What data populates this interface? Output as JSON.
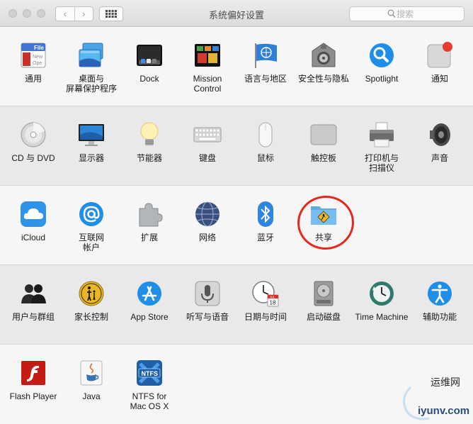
{
  "window": {
    "title": "系统偏好设置",
    "back_glyph": "‹",
    "forward_glyph": "›",
    "search_placeholder": "搜索"
  },
  "sections": [
    [
      {
        "label": "通用",
        "icon": "general-icon"
      },
      {
        "label": "桌面与\n屏幕保护程序",
        "icon": "desktop-screensaver-icon"
      },
      {
        "label": "Dock",
        "icon": "dock-icon"
      },
      {
        "label": "Mission\nControl",
        "icon": "mission-control-icon"
      },
      {
        "label": "语言与地区",
        "icon": "language-region-icon"
      },
      {
        "label": "安全性与隐私",
        "icon": "security-privacy-icon"
      },
      {
        "label": "Spotlight",
        "icon": "spotlight-icon"
      },
      {
        "label": "通知",
        "icon": "notifications-icon"
      }
    ],
    [
      {
        "label": "CD 与 DVD",
        "icon": "cd-dvd-icon"
      },
      {
        "label": "显示器",
        "icon": "displays-icon"
      },
      {
        "label": "节能器",
        "icon": "energy-saver-icon"
      },
      {
        "label": "键盘",
        "icon": "keyboard-icon"
      },
      {
        "label": "鼠标",
        "icon": "mouse-icon"
      },
      {
        "label": "触控板",
        "icon": "trackpad-icon"
      },
      {
        "label": "打印机与\n扫描仪",
        "icon": "printer-scanner-icon"
      },
      {
        "label": "声音",
        "icon": "sound-icon"
      }
    ],
    [
      {
        "label": "iCloud",
        "icon": "icloud-icon"
      },
      {
        "label": "互联网\n帐户",
        "icon": "internet-accounts-icon"
      },
      {
        "label": "扩展",
        "icon": "extensions-icon"
      },
      {
        "label": "网络",
        "icon": "network-icon"
      },
      {
        "label": "蓝牙",
        "icon": "bluetooth-icon"
      },
      {
        "label": "共享",
        "icon": "sharing-icon"
      }
    ],
    [
      {
        "label": "用户与群组",
        "icon": "users-groups-icon"
      },
      {
        "label": "家长控制",
        "icon": "parental-controls-icon"
      },
      {
        "label": "App Store",
        "icon": "app-store-icon"
      },
      {
        "label": "听写与语音",
        "icon": "dictation-speech-icon"
      },
      {
        "label": "日期与时间",
        "icon": "date-time-icon"
      },
      {
        "label": "启动磁盘",
        "icon": "startup-disk-icon"
      },
      {
        "label": "Time Machine",
        "icon": "time-machine-icon"
      },
      {
        "label": "辅助功能",
        "icon": "accessibility-icon"
      }
    ],
    [
      {
        "label": "Flash Player",
        "icon": "flash-player-icon"
      },
      {
        "label": "Java",
        "icon": "java-icon"
      },
      {
        "label": "NTFS for\nMac OS X",
        "icon": "ntfs-icon"
      }
    ]
  ],
  "icon_text": {
    "general_file": "File",
    "general_new": "New",
    "general_open": "Ope",
    "calendar_month": "JUL",
    "calendar_day": "18",
    "ntfs": "NTFS"
  },
  "watermark": {
    "name": "运维网",
    "url": "iyunv.com"
  },
  "colors": {
    "highlight_circle": "#e5281c",
    "accent_blue": "#1f8ee8"
  }
}
